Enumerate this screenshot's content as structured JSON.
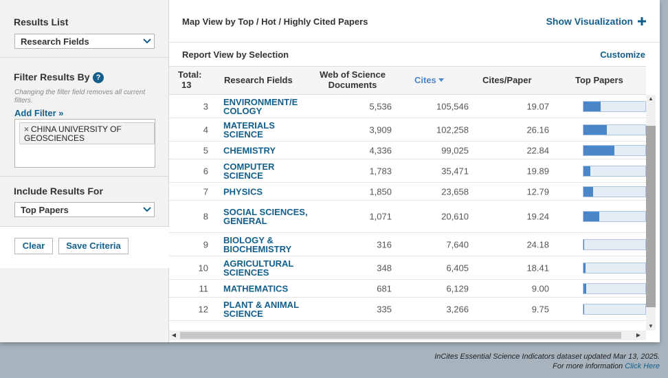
{
  "sidebar": {
    "results_list_label": "Results List",
    "results_list_value": "Research Fields",
    "filter_label": "Filter Results By",
    "help_icon": "?",
    "hint": "Changing the filter field removes all current filters.",
    "add_filter": "Add Filter »",
    "filter_chip_remove": "×",
    "filter_chip": "CHINA UNIVERSITY OF GEOSCIENCES",
    "include_label": "Include Results For",
    "include_value": "Top Papers",
    "clear_button": "Clear",
    "save_button": "Save Criteria"
  },
  "main": {
    "map_title": "Map View by Top / Hot / Highly Cited Papers",
    "show_viz": "Show Visualization",
    "show_viz_icon": "plus-icon",
    "report_title": "Report View by Selection",
    "customize": "Customize"
  },
  "table": {
    "headers": {
      "total": "Total:",
      "total_count": "13",
      "field": "Research Fields",
      "docs": "Web of Science Documents",
      "cites": "Cites",
      "cites_sort_icon": "sort-down-icon",
      "cpp": "Cites/Paper",
      "top": "Top Papers"
    },
    "rows": [
      {
        "rank": "3",
        "field": "ENVIRONMENT/E COLOGY",
        "docs": "5,536",
        "cites": "105,546",
        "cpp": "19.07",
        "top_fraction": 0.28
      },
      {
        "rank": "4",
        "field": "MATERIALS SCIENCE",
        "docs": "3,909",
        "cites": "102,258",
        "cpp": "26.16",
        "top_fraction": 0.38
      },
      {
        "rank": "5",
        "field": "CHEMISTRY",
        "docs": "4,336",
        "cites": "99,025",
        "cpp": "22.84",
        "top_fraction": 0.5
      },
      {
        "rank": "6",
        "field": "COMPUTER SCIENCE",
        "docs": "1,783",
        "cites": "35,471",
        "cpp": "19.89",
        "top_fraction": 0.11
      },
      {
        "rank": "7",
        "field": "PHYSICS",
        "docs": "1,850",
        "cites": "23,658",
        "cpp": "12.79",
        "top_fraction": 0.15
      },
      {
        "rank": "8",
        "field": "SOCIAL SCIENCES, GENERAL",
        "docs": "1,071",
        "cites": "20,610",
        "cpp": "19.24",
        "top_fraction": 0.26
      },
      {
        "rank": "9",
        "field": "BIOLOGY & BIOCHEMISTRY",
        "docs": "316",
        "cites": "7,640",
        "cpp": "24.18",
        "top_fraction": 0.01
      },
      {
        "rank": "10",
        "field": "AGRICULTURAL SCIENCES",
        "docs": "348",
        "cites": "6,405",
        "cpp": "18.41",
        "top_fraction": 0.03
      },
      {
        "rank": "11",
        "field": "MATHEMATICS",
        "docs": "681",
        "cites": "6,129",
        "cpp": "9.00",
        "top_fraction": 0.04
      },
      {
        "rank": "12",
        "field": "PLANT & ANIMAL SCIENCE",
        "docs": "335",
        "cites": "3,266",
        "cpp": "9.75",
        "top_fraction": 0.01
      }
    ]
  },
  "footer": {
    "line1": "InCites Essential Science Indicators dataset updated Mar 13, 2025.",
    "line2": "For more information",
    "link": "Click Here"
  },
  "colors": {
    "accent": "#135f8c",
    "bar_fill": "#4a86c8",
    "bar_bg": "#e4ecf6"
  }
}
